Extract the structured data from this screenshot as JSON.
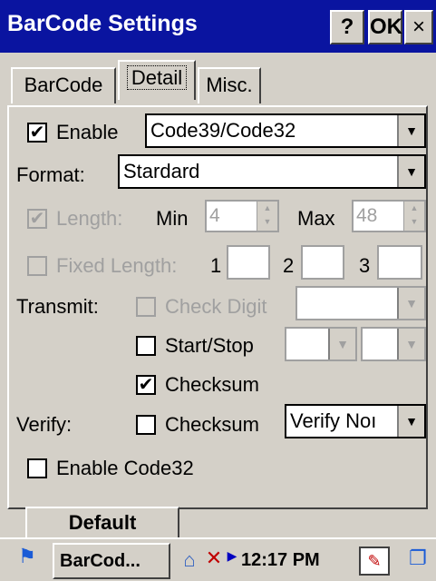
{
  "window": {
    "title": "BarCode Settings",
    "help_label": "?",
    "ok_label": "OK",
    "close_label": "×"
  },
  "tabs": [
    {
      "label": "BarCode",
      "active": false
    },
    {
      "label": "Detail",
      "active": true
    },
    {
      "label": "Misc.",
      "active": false
    }
  ],
  "detail": {
    "enable": {
      "label": "Enable",
      "checked": true,
      "symbology": "Code39/Code32"
    },
    "format": {
      "label": "Format:",
      "value": "Stardard"
    },
    "length": {
      "label": "Length:",
      "checked": true,
      "enabled": false,
      "min_label": "Min",
      "min_value": "4",
      "max_label": "Max",
      "max_value": "48"
    },
    "fixed_length": {
      "label": "Fixed Length:",
      "checked": false,
      "enabled": false,
      "labels": [
        "1",
        "2",
        "3"
      ]
    },
    "transmit": {
      "label": "Transmit:",
      "check_digit": {
        "label": "Check Digit",
        "checked": false,
        "enabled": false
      },
      "start_stop": {
        "label": "Start/Stop",
        "checked": false
      },
      "checksum": {
        "label": "Checksum",
        "checked": true
      }
    },
    "verify": {
      "label": "Verify:",
      "checksum": {
        "label": "Checksum",
        "checked": false
      },
      "mode": "Verify Noı"
    },
    "enable_code32": {
      "label": "Enable Code32",
      "checked": false
    },
    "default_button": "Default"
  },
  "taskbar": {
    "app_button": "BarCod...",
    "time": "12:17 PM",
    "icons": [
      "start-flag-icon",
      "network-icon",
      "no-connection-icon",
      "arrow-icon",
      "keyboard-icon",
      "windows-switch-icon"
    ]
  },
  "colors": {
    "titlebar": "#0a14a0",
    "face": "#d4d0c8",
    "disabled_text": "#a0a0a0"
  }
}
